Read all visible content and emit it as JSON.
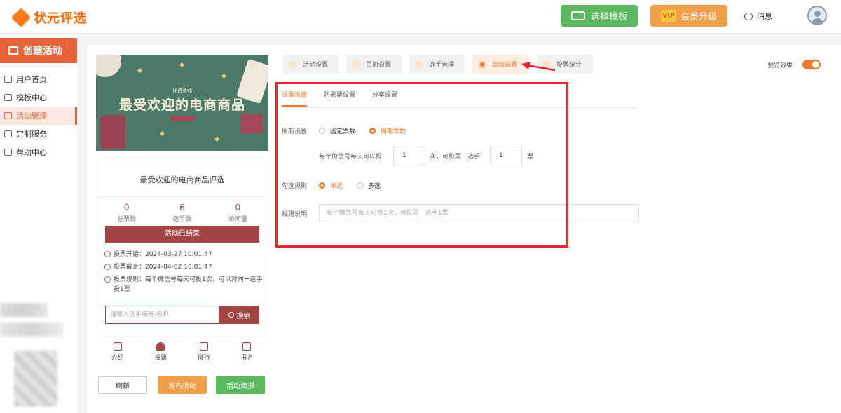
{
  "header": {
    "logo_text": "状元评选",
    "select_template_label": "选择模板",
    "vip_badge": "VIP",
    "vip_label": "会员升级",
    "messages_label": "消息"
  },
  "sidebar": {
    "create_label": "创建活动",
    "items": [
      {
        "label": "用户首页",
        "icon": "home-icon"
      },
      {
        "label": "模板中心",
        "icon": "folder-icon"
      },
      {
        "label": "活动管理",
        "icon": "ticket-icon",
        "active": true
      },
      {
        "label": "定制服务",
        "icon": "tools-icon"
      },
      {
        "label": "帮助中心",
        "icon": "book-icon"
      }
    ]
  },
  "preview": {
    "banner_subtitle": "· 评选活动 ·",
    "banner_title": "最受欢迎的电商商品",
    "activity_title": "最受欢迎的电商商品评选",
    "stats": [
      {
        "value": "0",
        "label": "总票数"
      },
      {
        "value": "6",
        "label": "选手数"
      },
      {
        "value": "0",
        "label": "访问量"
      }
    ],
    "ended_label": "活动已结束",
    "vote_start": "投票开始：2024-03-27 10:01:47",
    "vote_end": "投票截止：2024-04-02 10:01:47",
    "vote_rule": "投票规则：每个微信号每天可投1次，可以对同一选手投1票",
    "search_placeholder": "请输入选手编号/名称",
    "search_button": "搜索",
    "tabs": [
      {
        "label": "介绍"
      },
      {
        "label": "投票",
        "active": true
      },
      {
        "label": "排行"
      },
      {
        "label": "报名"
      }
    ],
    "refresh_label": "刷新",
    "publish_label": "发布活动",
    "poster_label": "活动海报"
  },
  "settings_tabs": [
    {
      "label": "活动设置"
    },
    {
      "label": "页面设置"
    },
    {
      "label": "选手管理"
    },
    {
      "label": "高级设置",
      "active": true
    },
    {
      "label": "投票统计"
    }
  ],
  "preview_toggle": {
    "label": "预览效果",
    "on": true
  },
  "advanced": {
    "sub_tabs": [
      {
        "label": "投票设置",
        "active": true
      },
      {
        "label": "防刷票设置"
      },
      {
        "label": "分享设置"
      }
    ],
    "period_label": "周期设置",
    "period_options": [
      "固定票数",
      "周期票数"
    ],
    "period_selected": "周期票数",
    "per_day_prefix": "每个微信号每天可以投",
    "per_day_value": "1",
    "per_day_mid": "次，可投同一选手",
    "same_player_value": "1",
    "per_day_suffix": "票",
    "select_rule_label": "勾选规则",
    "select_options": [
      "单选",
      "多选"
    ],
    "select_selected": "单选",
    "rule_desc_label": "规则说明",
    "rule_desc_placeholder": "每个微信号每天可投1次，可投同一选手1票"
  },
  "colors": {
    "accent": "#f07b2a",
    "brand_red": "#a14545",
    "highlight_box": "#e8262a"
  }
}
